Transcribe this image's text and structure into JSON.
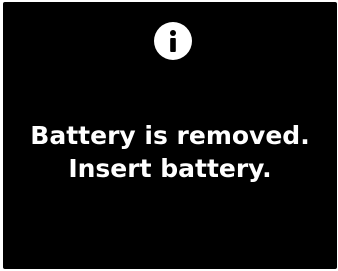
{
  "icon": "info-icon",
  "colors": {
    "background": "#000000",
    "foreground": "#ffffff"
  },
  "message": {
    "line1": "Battery is removed.",
    "line2": "Insert battery."
  }
}
